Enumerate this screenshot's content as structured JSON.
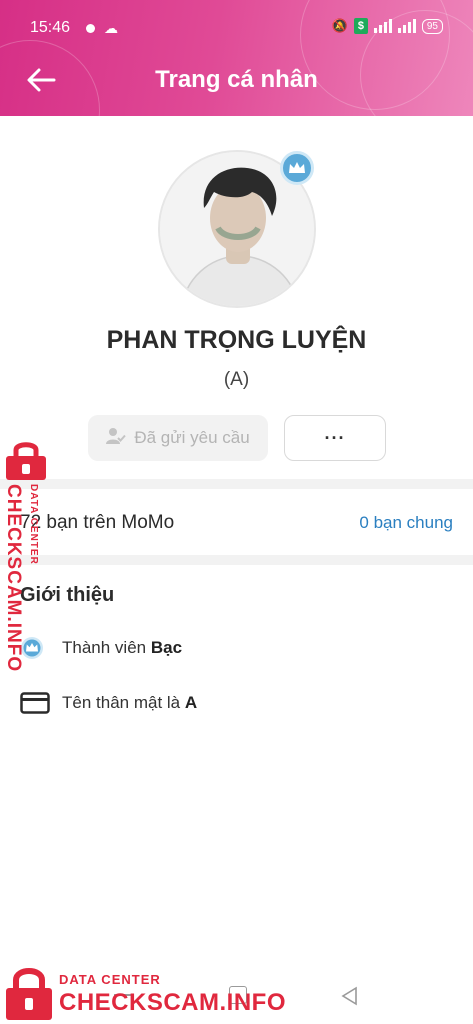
{
  "status_bar": {
    "time": "15:46",
    "battery": "95"
  },
  "header": {
    "title": "Trang cá nhân"
  },
  "profile": {
    "name": "PHAN TRỌNG LUYỆN",
    "nickname": "(A)",
    "request_sent_label": "Đã gửi yêu cầu",
    "more_label": "···"
  },
  "friends": {
    "count_label": "72 bạn trên MoMo",
    "mutual_label": "0 bạn chung"
  },
  "intro": {
    "title": "Giới thiệu",
    "member_prefix": "Thành viên ",
    "member_tier": "Bạc",
    "nickname_prefix": "Tên thân mật là ",
    "nickname_value": "A"
  },
  "watermark": {
    "small": "DATA CENTER",
    "big": "CHECKSCAM.INFO"
  },
  "colors": {
    "header_start": "#d62f86",
    "header_end": "#ee86bb",
    "link": "#2a7fc0",
    "watermark": "#e0283e",
    "crown": "#5aa9d8"
  }
}
